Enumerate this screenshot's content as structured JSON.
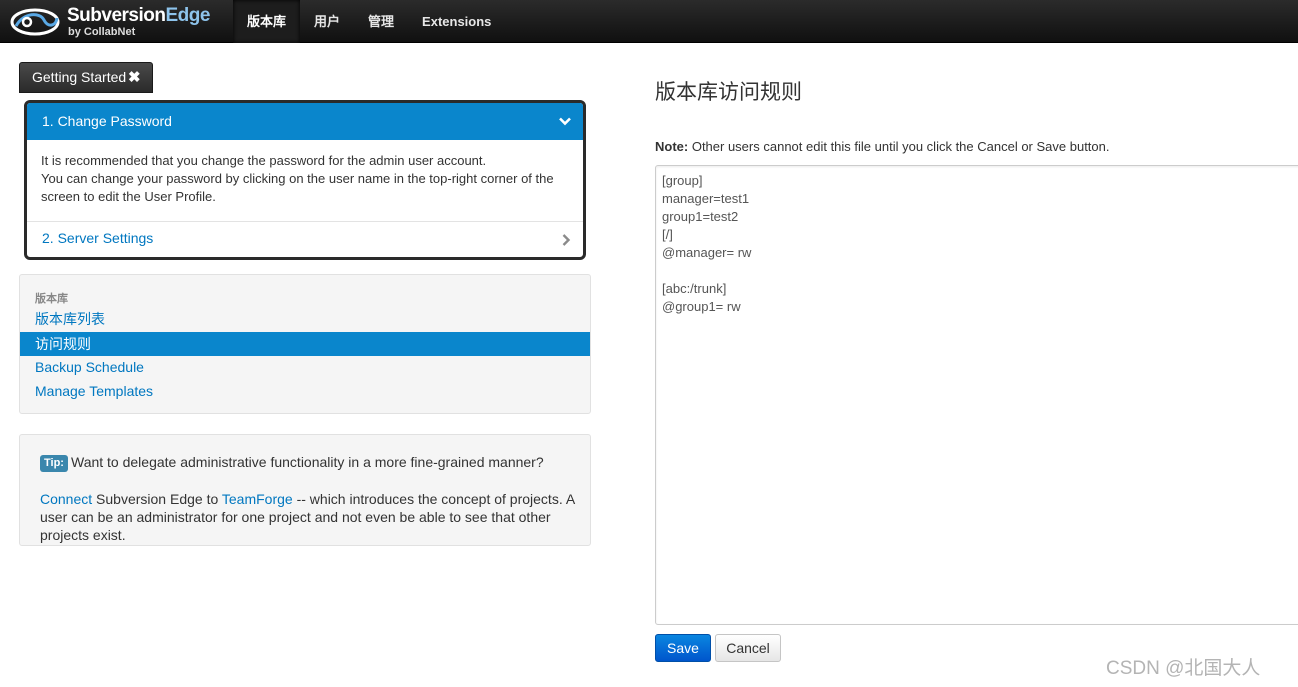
{
  "navbar": {
    "brand_name_main": "Subversion",
    "brand_name_accent": "Edge",
    "brand_sub": "by CollabNet",
    "logo_icon": "collabnet-swirl-icon",
    "items": [
      {
        "label": "版本库",
        "active": true
      },
      {
        "label": "用户",
        "active": false
      },
      {
        "label": "管理",
        "active": false
      },
      {
        "label": "Extensions",
        "active": false
      }
    ]
  },
  "getting_started": {
    "button_label": "Getting Started",
    "close_glyph": "✖",
    "step1_label": "1. Change Password",
    "step1_text_line1": "It is recommended that you change the password for the admin user account.",
    "step1_text_line2": "You can change your password by clicking on the user name in the top-right corner of the screen to edit the User Profile.",
    "step2_label": "2. Server Settings"
  },
  "sidebar": {
    "header": "版本库",
    "items": [
      {
        "label": "版本库列表",
        "active": false
      },
      {
        "label": "访问规则",
        "active": true
      },
      {
        "label": "Backup Schedule",
        "active": false
      },
      {
        "label": "Manage Templates",
        "active": false
      }
    ]
  },
  "tip": {
    "badge": "Tip:",
    "question": "Want to delegate administrative functionality in a more fine-grained manner?",
    "link1": "Connect",
    "text1": " Subversion Edge to ",
    "link2": "TeamForge",
    "text2": " -- which introduces the concept of projects. A user can be an administrator for one project and not even be able to see that other projects exist."
  },
  "main": {
    "title": "版本库访问规则",
    "note_label": "Note:",
    "note_text": " Other users cannot edit this file until you click the Cancel or Save button.",
    "editor_lines": [
      "[group]",
      "manager=test1",
      "group1=test2",
      "[/]",
      "@manager= rw",
      "",
      "[abc:/trunk]",
      "@group1= rw"
    ],
    "save_label": "Save",
    "cancel_label": "Cancel"
  },
  "watermark": "CSDN @北国大人",
  "colors": {
    "accent_blue": "#0a86cc",
    "link_blue": "#0077c0",
    "navbar_bg": "#1a1a1a"
  }
}
